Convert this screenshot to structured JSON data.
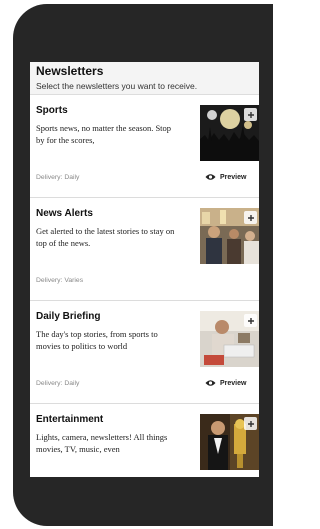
{
  "header": {
    "title": "Newsletters",
    "subtitle": "Select the newsletters you want to receive."
  },
  "preview_label": "Preview",
  "icons": {
    "preview": "eye-icon",
    "add": "plus-icon"
  },
  "colors": {
    "frame": "#262626",
    "header_bg": "#f4f4f4",
    "text": "#111111",
    "muted": "#888888"
  },
  "newsletters": [
    {
      "title": "Sports",
      "description": "Sports news, no matter the season. Stop by for the scores,",
      "delivery": "Delivery: Daily",
      "has_preview": true
    },
    {
      "title": "News Alerts",
      "description": "Get alerted to the latest stories to stay on top of the news.",
      "delivery": "Delivery: Varies",
      "has_preview": false
    },
    {
      "title": "Daily Briefing",
      "description": "The day's top stories, from sports to movies to politics to world",
      "delivery": "Delivery: Daily",
      "has_preview": true
    },
    {
      "title": "Entertainment",
      "description": "Lights, camera, newsletters! All things movies, TV, music, even",
      "delivery": "",
      "has_preview": false
    }
  ]
}
